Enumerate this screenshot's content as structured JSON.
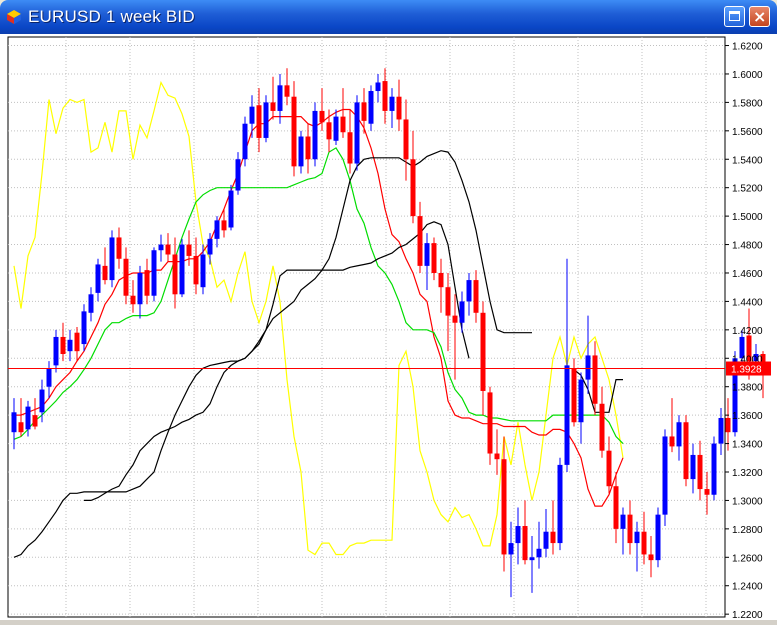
{
  "window": {
    "title": "EURUSD 1 week BID",
    "buttons": {
      "maximize_icon": "maximize-icon",
      "close_icon": "close-icon",
      "close_glyph": "×"
    }
  },
  "chart_data": {
    "type": "candlestick",
    "title": "EURUSD 1 week BID",
    "price_axis": {
      "position": "right",
      "ylim": [
        1.218,
        1.626
      ],
      "ticks": [
        "1.6200",
        "1.6000",
        "1.5800",
        "1.5600",
        "1.5400",
        "1.5200",
        "1.5000",
        "1.4800",
        "1.4600",
        "1.4400",
        "1.4200",
        "1.4000",
        "1.3800",
        "1.3600",
        "1.3400",
        "1.3200",
        "1.3000",
        "1.2800",
        "1.2600",
        "1.2400",
        "1.2200"
      ]
    },
    "current_price": {
      "label": "1.3928",
      "value": 1.3928,
      "color": "#ff0000"
    },
    "grid": true,
    "bull_color": "#0000ff",
    "bear_color": "#ff0000",
    "candles": [
      {
        "o": 1.348,
        "h": 1.372,
        "l": 1.336,
        "c": 1.362
      },
      {
        "o": 1.355,
        "h": 1.372,
        "l": 1.345,
        "c": 1.348
      },
      {
        "o": 1.35,
        "h": 1.37,
        "l": 1.345,
        "c": 1.366
      },
      {
        "o": 1.36,
        "h": 1.372,
        "l": 1.35,
        "c": 1.352
      },
      {
        "o": 1.362,
        "h": 1.385,
        "l": 1.355,
        "c": 1.378
      },
      {
        "o": 1.38,
        "h": 1.398,
        "l": 1.372,
        "c": 1.393
      },
      {
        "o": 1.395,
        "h": 1.42,
        "l": 1.39,
        "c": 1.415
      },
      {
        "o": 1.415,
        "h": 1.425,
        "l": 1.398,
        "c": 1.403
      },
      {
        "o": 1.405,
        "h": 1.42,
        "l": 1.398,
        "c": 1.413
      },
      {
        "o": 1.418,
        "h": 1.422,
        "l": 1.398,
        "c": 1.405
      },
      {
        "o": 1.41,
        "h": 1.438,
        "l": 1.405,
        "c": 1.433
      },
      {
        "o": 1.432,
        "h": 1.45,
        "l": 1.426,
        "c": 1.445
      },
      {
        "o": 1.446,
        "h": 1.47,
        "l": 1.44,
        "c": 1.466
      },
      {
        "o": 1.465,
        "h": 1.478,
        "l": 1.452,
        "c": 1.455
      },
      {
        "o": 1.455,
        "h": 1.49,
        "l": 1.45,
        "c": 1.485
      },
      {
        "o": 1.485,
        "h": 1.492,
        "l": 1.463,
        "c": 1.47
      },
      {
        "o": 1.47,
        "h": 1.478,
        "l": 1.438,
        "c": 1.444
      },
      {
        "o": 1.444,
        "h": 1.455,
        "l": 1.432,
        "c": 1.438
      },
      {
        "o": 1.438,
        "h": 1.465,
        "l": 1.428,
        "c": 1.46
      },
      {
        "o": 1.462,
        "h": 1.47,
        "l": 1.438,
        "c": 1.444
      },
      {
        "o": 1.444,
        "h": 1.478,
        "l": 1.44,
        "c": 1.476
      },
      {
        "o": 1.476,
        "h": 1.487,
        "l": 1.468,
        "c": 1.48
      },
      {
        "o": 1.48,
        "h": 1.488,
        "l": 1.468,
        "c": 1.473
      },
      {
        "o": 1.473,
        "h": 1.485,
        "l": 1.435,
        "c": 1.445
      },
      {
        "o": 1.445,
        "h": 1.484,
        "l": 1.443,
        "c": 1.48
      },
      {
        "o": 1.48,
        "h": 1.49,
        "l": 1.465,
        "c": 1.472
      },
      {
        "o": 1.472,
        "h": 1.485,
        "l": 1.445,
        "c": 1.452
      },
      {
        "o": 1.45,
        "h": 1.48,
        "l": 1.445,
        "c": 1.473
      },
      {
        "o": 1.473,
        "h": 1.488,
        "l": 1.466,
        "c": 1.484
      },
      {
        "o": 1.484,
        "h": 1.5,
        "l": 1.478,
        "c": 1.497
      },
      {
        "o": 1.497,
        "h": 1.505,
        "l": 1.485,
        "c": 1.49
      },
      {
        "o": 1.492,
        "h": 1.522,
        "l": 1.49,
        "c": 1.518
      },
      {
        "o": 1.518,
        "h": 1.545,
        "l": 1.515,
        "c": 1.54
      },
      {
        "o": 1.54,
        "h": 1.57,
        "l": 1.535,
        "c": 1.565
      },
      {
        "o": 1.565,
        "h": 1.585,
        "l": 1.555,
        "c": 1.577
      },
      {
        "o": 1.578,
        "h": 1.59,
        "l": 1.545,
        "c": 1.555
      },
      {
        "o": 1.555,
        "h": 1.585,
        "l": 1.552,
        "c": 1.58
      },
      {
        "o": 1.58,
        "h": 1.598,
        "l": 1.568,
        "c": 1.574
      },
      {
        "o": 1.574,
        "h": 1.6,
        "l": 1.565,
        "c": 1.592
      },
      {
        "o": 1.592,
        "h": 1.604,
        "l": 1.578,
        "c": 1.584
      },
      {
        "o": 1.584,
        "h": 1.595,
        "l": 1.528,
        "c": 1.535
      },
      {
        "o": 1.535,
        "h": 1.56,
        "l": 1.53,
        "c": 1.556
      },
      {
        "o": 1.556,
        "h": 1.565,
        "l": 1.53,
        "c": 1.54
      },
      {
        "o": 1.54,
        "h": 1.58,
        "l": 1.535,
        "c": 1.574
      },
      {
        "o": 1.574,
        "h": 1.59,
        "l": 1.56,
        "c": 1.566
      },
      {
        "o": 1.566,
        "h": 1.575,
        "l": 1.545,
        "c": 1.554
      },
      {
        "o": 1.553,
        "h": 1.575,
        "l": 1.55,
        "c": 1.57
      },
      {
        "o": 1.57,
        "h": 1.59,
        "l": 1.555,
        "c": 1.559
      },
      {
        "o": 1.559,
        "h": 1.575,
        "l": 1.53,
        "c": 1.537
      },
      {
        "o": 1.537,
        "h": 1.585,
        "l": 1.532,
        "c": 1.58
      },
      {
        "o": 1.58,
        "h": 1.59,
        "l": 1.558,
        "c": 1.567
      },
      {
        "o": 1.565,
        "h": 1.592,
        "l": 1.56,
        "c": 1.588
      },
      {
        "o": 1.588,
        "h": 1.6,
        "l": 1.58,
        "c": 1.594
      },
      {
        "o": 1.595,
        "h": 1.604,
        "l": 1.565,
        "c": 1.574
      },
      {
        "o": 1.574,
        "h": 1.59,
        "l": 1.562,
        "c": 1.584
      },
      {
        "o": 1.584,
        "h": 1.596,
        "l": 1.56,
        "c": 1.568
      },
      {
        "o": 1.568,
        "h": 1.582,
        "l": 1.525,
        "c": 1.54
      },
      {
        "o": 1.54,
        "h": 1.56,
        "l": 1.495,
        "c": 1.5
      },
      {
        "o": 1.5,
        "h": 1.51,
        "l": 1.46,
        "c": 1.465
      },
      {
        "o": 1.465,
        "h": 1.488,
        "l": 1.448,
        "c": 1.481
      },
      {
        "o": 1.481,
        "h": 1.485,
        "l": 1.455,
        "c": 1.46
      },
      {
        "o": 1.46,
        "h": 1.47,
        "l": 1.432,
        "c": 1.45
      },
      {
        "o": 1.45,
        "h": 1.46,
        "l": 1.405,
        "c": 1.43
      },
      {
        "o": 1.43,
        "h": 1.445,
        "l": 1.385,
        "c": 1.425
      },
      {
        "o": 1.425,
        "h": 1.447,
        "l": 1.418,
        "c": 1.44
      },
      {
        "o": 1.44,
        "h": 1.46,
        "l": 1.43,
        "c": 1.455
      },
      {
        "o": 1.455,
        "h": 1.462,
        "l": 1.425,
        "c": 1.432
      },
      {
        "o": 1.432,
        "h": 1.44,
        "l": 1.36,
        "c": 1.377
      },
      {
        "o": 1.376,
        "h": 1.38,
        "l": 1.325,
        "c": 1.333
      },
      {
        "o": 1.333,
        "h": 1.35,
        "l": 1.318,
        "c": 1.329
      },
      {
        "o": 1.329,
        "h": 1.345,
        "l": 1.25,
        "c": 1.262
      },
      {
        "o": 1.262,
        "h": 1.285,
        "l": 1.232,
        "c": 1.27
      },
      {
        "o": 1.27,
        "h": 1.295,
        "l": 1.255,
        "c": 1.282
      },
      {
        "o": 1.282,
        "h": 1.3,
        "l": 1.255,
        "c": 1.258
      },
      {
        "o": 1.258,
        "h": 1.275,
        "l": 1.235,
        "c": 1.26
      },
      {
        "o": 1.26,
        "h": 1.285,
        "l": 1.252,
        "c": 1.266
      },
      {
        "o": 1.266,
        "h": 1.294,
        "l": 1.26,
        "c": 1.278
      },
      {
        "o": 1.278,
        "h": 1.3,
        "l": 1.262,
        "c": 1.27
      },
      {
        "o": 1.27,
        "h": 1.33,
        "l": 1.265,
        "c": 1.325
      },
      {
        "o": 1.325,
        "h": 1.47,
        "l": 1.32,
        "c": 1.395
      },
      {
        "o": 1.393,
        "h": 1.4,
        "l": 1.352,
        "c": 1.355
      },
      {
        "o": 1.355,
        "h": 1.39,
        "l": 1.34,
        "c": 1.385
      },
      {
        "o": 1.385,
        "h": 1.43,
        "l": 1.375,
        "c": 1.402
      },
      {
        "o": 1.402,
        "h": 1.412,
        "l": 1.36,
        "c": 1.368
      },
      {
        "o": 1.368,
        "h": 1.38,
        "l": 1.33,
        "c": 1.335
      },
      {
        "o": 1.335,
        "h": 1.345,
        "l": 1.305,
        "c": 1.31
      },
      {
        "o": 1.31,
        "h": 1.32,
        "l": 1.27,
        "c": 1.28
      },
      {
        "o": 1.28,
        "h": 1.295,
        "l": 1.262,
        "c": 1.29
      },
      {
        "o": 1.29,
        "h": 1.3,
        "l": 1.262,
        "c": 1.27
      },
      {
        "o": 1.27,
        "h": 1.285,
        "l": 1.25,
        "c": 1.278
      },
      {
        "o": 1.278,
        "h": 1.292,
        "l": 1.255,
        "c": 1.262
      },
      {
        "o": 1.262,
        "h": 1.275,
        "l": 1.246,
        "c": 1.258
      },
      {
        "o": 1.258,
        "h": 1.295,
        "l": 1.253,
        "c": 1.29
      },
      {
        "o": 1.29,
        "h": 1.35,
        "l": 1.282,
        "c": 1.345
      },
      {
        "o": 1.345,
        "h": 1.372,
        "l": 1.334,
        "c": 1.338
      },
      {
        "o": 1.338,
        "h": 1.36,
        "l": 1.328,
        "c": 1.355
      },
      {
        "o": 1.355,
        "h": 1.36,
        "l": 1.31,
        "c": 1.315
      },
      {
        "o": 1.315,
        "h": 1.34,
        "l": 1.305,
        "c": 1.332
      },
      {
        "o": 1.332,
        "h": 1.342,
        "l": 1.3,
        "c": 1.308
      },
      {
        "o": 1.308,
        "h": 1.32,
        "l": 1.29,
        "c": 1.304
      },
      {
        "o": 1.304,
        "h": 1.345,
        "l": 1.3,
        "c": 1.34
      },
      {
        "o": 1.34,
        "h": 1.365,
        "l": 1.332,
        "c": 1.358
      },
      {
        "o": 1.358,
        "h": 1.372,
        "l": 1.335,
        "c": 1.348
      },
      {
        "o": 1.348,
        "h": 1.405,
        "l": 1.345,
        "c": 1.4
      },
      {
        "o": 1.4,
        "h": 1.42,
        "l": 1.39,
        "c": 1.415
      },
      {
        "o": 1.416,
        "h": 1.435,
        "l": 1.385,
        "c": 1.398
      },
      {
        "o": 1.398,
        "h": 1.41,
        "l": 1.388,
        "c": 1.403
      },
      {
        "o": 1.403,
        "h": 1.405,
        "l": 1.372,
        "c": 1.393
      }
    ],
    "indicator_series": [
      {
        "color": "#ffff00",
        "values": [
          1.465,
          1.435,
          1.472,
          1.485,
          1.53,
          1.582,
          1.558,
          1.576,
          1.582,
          1.58,
          1.582,
          1.545,
          1.548,
          1.566,
          1.545,
          1.574,
          1.574,
          1.54,
          1.564,
          1.555,
          1.574,
          1.594,
          1.585,
          1.583,
          1.572,
          1.556,
          1.51,
          1.48,
          1.47,
          1.45,
          1.455,
          1.44,
          1.46,
          1.475,
          1.44,
          1.425,
          1.44,
          1.465,
          1.44,
          1.385,
          1.345,
          1.32,
          1.265,
          1.262,
          1.27,
          1.27,
          1.262,
          1.262,
          1.268,
          1.27,
          1.27,
          1.272,
          1.272,
          1.272,
          1.272,
          1.395,
          1.405,
          1.38,
          1.335,
          1.32,
          1.3,
          1.29,
          1.285,
          1.295,
          1.288,
          1.29,
          1.28,
          1.268,
          1.268,
          1.29,
          1.345,
          1.325,
          1.355,
          1.325,
          1.3,
          1.32,
          1.36,
          1.4,
          1.415,
          1.395,
          1.415,
          1.4,
          1.41,
          1.415,
          1.4,
          1.385,
          1.36,
          1.33
        ]
      },
      {
        "color": "#ff0000",
        "values": [
          1.36,
          1.36,
          1.362,
          1.364,
          1.366,
          1.372,
          1.38,
          1.385,
          1.39,
          1.398,
          1.405,
          1.415,
          1.425,
          1.438,
          1.445,
          1.455,
          1.458,
          1.46,
          1.46,
          1.46,
          1.462,
          1.462,
          1.468,
          1.468,
          1.468,
          1.47,
          1.47,
          1.475,
          1.482,
          1.494,
          1.505,
          1.518,
          1.53,
          1.545,
          1.56,
          1.565,
          1.565,
          1.57,
          1.57,
          1.57,
          1.57,
          1.57,
          1.565,
          1.563,
          1.566,
          1.57,
          1.573,
          1.575,
          1.575,
          1.57,
          1.562,
          1.548,
          1.53,
          1.505,
          1.487,
          1.482,
          1.47,
          1.46,
          1.445,
          1.44,
          1.415,
          1.4,
          1.37,
          1.36,
          1.358,
          1.358,
          1.356,
          1.354,
          1.354,
          1.354,
          1.352,
          1.352,
          1.352,
          1.352,
          1.348,
          1.346,
          1.346,
          1.35,
          1.35,
          1.348,
          1.34,
          1.33,
          1.308,
          1.296,
          1.296,
          1.304,
          1.318,
          1.33
        ]
      },
      {
        "color": "#00dd00",
        "values": [
          1.343,
          1.345,
          1.35,
          1.356,
          1.36,
          1.365,
          1.37,
          1.376,
          1.38,
          1.385,
          1.392,
          1.4,
          1.41,
          1.42,
          1.425,
          1.425,
          1.428,
          1.43,
          1.43,
          1.43,
          1.432,
          1.44,
          1.455,
          1.47,
          1.485,
          1.498,
          1.51,
          1.515,
          1.518,
          1.52,
          1.52,
          1.52,
          1.52,
          1.52,
          1.52,
          1.52,
          1.52,
          1.52,
          1.52,
          1.52,
          1.522,
          1.524,
          1.526,
          1.527,
          1.53,
          1.545,
          1.548,
          1.54,
          1.525,
          1.505,
          1.495,
          1.478,
          1.465,
          1.46,
          1.452,
          1.44,
          1.425,
          1.42,
          1.42,
          1.42,
          1.418,
          1.408,
          1.39,
          1.378,
          1.372,
          1.362,
          1.36,
          1.36,
          1.358,
          1.358,
          1.357,
          1.356,
          1.356,
          1.356,
          1.356,
          1.356,
          1.356,
          1.36,
          1.36,
          1.36,
          1.36,
          1.36,
          1.36,
          1.36,
          1.36,
          1.355,
          1.345,
          1.34
        ]
      },
      {
        "color": "#000000",
        "values": [
          1.3,
          1.3,
          1.302,
          1.305,
          1.308,
          1.31,
          1.318,
          1.325,
          1.335,
          1.34,
          1.345,
          1.348,
          1.35,
          1.352,
          1.355,
          1.357,
          1.36,
          1.362,
          1.368,
          1.38,
          1.39,
          1.395,
          1.398,
          1.4,
          1.405,
          1.412,
          1.42,
          1.428,
          1.432,
          1.436,
          1.44,
          1.448,
          1.452,
          1.456,
          1.462,
          1.47,
          1.485,
          1.505,
          1.525,
          1.535,
          1.54,
          1.541,
          1.541,
          1.541,
          1.541,
          1.541,
          1.538,
          1.535,
          1.538,
          1.542,
          1.544,
          1.546,
          1.545,
          1.538,
          1.525,
          1.51,
          1.49,
          1.465,
          1.44,
          1.42,
          1.418,
          1.418,
          1.418,
          1.418,
          1.418
        ]
      },
      {
        "color": "#000000",
        "values": [
          1.26,
          1.262,
          1.268,
          1.272,
          1.278,
          1.285,
          1.292,
          1.3,
          1.305,
          1.305,
          1.306,
          1.306,
          1.306,
          1.306,
          1.306,
          1.306,
          1.306,
          1.308,
          1.31,
          1.315,
          1.32,
          1.335,
          1.348,
          1.36,
          1.37,
          1.38,
          1.388,
          1.393,
          1.395,
          1.396,
          1.397,
          1.398,
          1.398,
          1.4,
          1.405,
          1.41,
          1.42,
          1.438,
          1.458,
          1.462,
          1.462,
          1.462,
          1.462,
          1.462,
          1.462,
          1.462,
          1.462,
          1.462,
          1.464,
          1.465,
          1.466,
          1.467,
          1.47,
          1.472,
          1.474,
          1.478,
          1.48,
          1.484,
          1.488,
          1.494,
          1.496,
          1.494,
          1.48,
          1.45,
          1.42,
          1.4
        ]
      },
      {
        "color": "#000000",
        "values": [
          1.392,
          1.388,
          1.378,
          1.362,
          1.362,
          1.362,
          1.385,
          1.385
        ]
      }
    ]
  }
}
